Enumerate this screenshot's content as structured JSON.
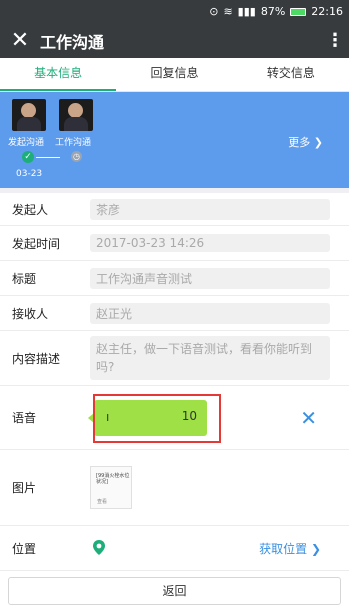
{
  "status_bar": {
    "battery": "87%",
    "time": "22:16"
  },
  "header": {
    "title": "工作沟通"
  },
  "tabs": [
    {
      "label": "基本信息",
      "active": true
    },
    {
      "label": "回复信息",
      "active": false
    },
    {
      "label": "转交信息",
      "active": false
    }
  ],
  "flow": {
    "people": [
      {
        "name": "发起沟通"
      },
      {
        "name": "工作沟通"
      }
    ],
    "date": "03-23",
    "more": "更多"
  },
  "form": {
    "initiator": {
      "label": "发起人",
      "value": "茶彦"
    },
    "start_time": {
      "label": "发起时间",
      "value": "2017-03-23 14:26"
    },
    "subject": {
      "label": "标题",
      "value": "工作沟通声音测试"
    },
    "receiver": {
      "label": "接收人",
      "value": "赵正光"
    },
    "description": {
      "label": "内容描述",
      "value": "赵主任，做一下语音测试，看看你能听到吗?"
    },
    "voice": {
      "label": "语音",
      "duration": "10"
    },
    "image": {
      "label": "图片",
      "thumb_title": "[99消火栓水位状况]",
      "thumb_footer": "查看"
    },
    "location": {
      "label": "位置",
      "action": "获取位置"
    }
  },
  "back_label": "返回",
  "colors": {
    "accent": "#1eae7a",
    "flow_bg": "#5d9bec",
    "voice": "#9ee045",
    "link": "#3a8fe0",
    "highlight": "#e53935"
  },
  "icons": [
    "close-icon",
    "kebab-menu-icon",
    "check-icon",
    "clock-icon",
    "chevron-right-icon",
    "location-pin-icon",
    "delete-x-icon"
  ]
}
